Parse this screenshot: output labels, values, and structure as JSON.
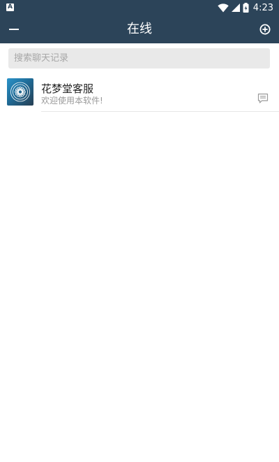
{
  "status_bar": {
    "notification_icon_letter": "A",
    "icons": [
      "wifi-icon",
      "cell-signal-icon",
      "battery-charging-icon"
    ],
    "time": "4:23"
  },
  "toolbar": {
    "title": "在线",
    "left_icon": "minus-icon",
    "right_icon": "add-circle-icon",
    "background": "#2c4459"
  },
  "search": {
    "placeholder": "搜索聊天记录"
  },
  "conversations": [
    {
      "name": "花梦堂客服",
      "preview": "欢迎使用本软件!",
      "avatar_icon": "mandala-logo",
      "action_icon": "message-icon"
    }
  ]
}
